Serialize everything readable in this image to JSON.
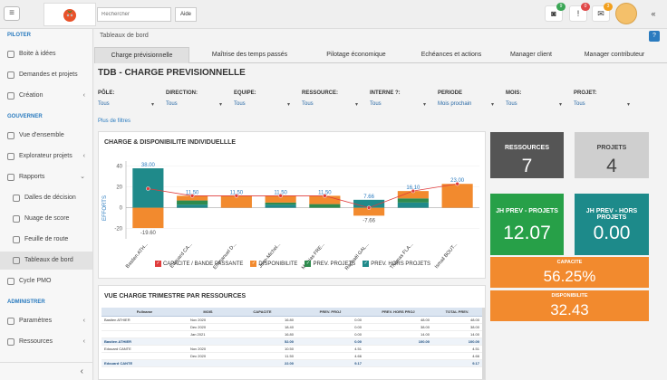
{
  "header": {
    "search_placeholder": "Rechercher",
    "aide_label": "Aide",
    "icons": [
      {
        "name": "camera-icon",
        "glyph": "◙",
        "badge": "9",
        "badge_color": "#3aa655"
      },
      {
        "name": "alert-icon",
        "glyph": "!",
        "badge": "0",
        "badge_color": "#e04848"
      },
      {
        "name": "mail-icon",
        "glyph": "✉",
        "badge": "3",
        "badge_color": "#f2a01e"
      }
    ],
    "collapse_glyph": "«"
  },
  "sidebar": {
    "sections": [
      {
        "title": "PILOTER",
        "items": [
          {
            "label": "Boite à idées",
            "sub": false,
            "active": false,
            "chevron": ""
          },
          {
            "label": "Demandes et projets",
            "sub": false,
            "active": false,
            "chevron": ""
          },
          {
            "label": "Création",
            "sub": false,
            "active": false,
            "chevron": "‹"
          }
        ]
      },
      {
        "title": "GOUVERNER",
        "items": [
          {
            "label": "Vue d'ensemble",
            "sub": false,
            "active": false,
            "chevron": ""
          },
          {
            "label": "Explorateur projets",
            "sub": false,
            "active": false,
            "chevron": "‹"
          },
          {
            "label": "Rapports",
            "sub": false,
            "active": false,
            "chevron": "⌄"
          },
          {
            "label": "Dalles de décision",
            "sub": true,
            "active": false,
            "chevron": ""
          },
          {
            "label": "Nuage de score",
            "sub": true,
            "active": false,
            "chevron": ""
          },
          {
            "label": "Feuille de route",
            "sub": true,
            "active": false,
            "chevron": ""
          },
          {
            "label": "Tableaux de bord",
            "sub": true,
            "active": true,
            "chevron": ""
          },
          {
            "label": "Cycle PMO",
            "sub": false,
            "active": false,
            "chevron": ""
          }
        ]
      },
      {
        "title": "ADMINISTRER",
        "items": [
          {
            "label": "Paramètres",
            "sub": false,
            "active": false,
            "chevron": "‹"
          },
          {
            "label": "Ressources",
            "sub": false,
            "active": false,
            "chevron": "‹"
          }
        ]
      }
    ],
    "footer_glyph": "‹"
  },
  "main": {
    "breadcrumb": "Tableaux de bord",
    "help_label": "?",
    "tabs": [
      {
        "label": "Charge prévisionnelle",
        "active": true
      },
      {
        "label": "Maîtrise des temps passés",
        "active": false
      },
      {
        "label": "Pilotage économique",
        "active": false
      },
      {
        "label": "Echéances et actions",
        "active": false
      },
      {
        "label": "Manager client",
        "active": false
      },
      {
        "label": "Manager contributeur",
        "active": false
      }
    ],
    "page_title": "TDB - CHARGE PREVISIONNELLE",
    "filters": [
      {
        "label": "PÔLE:",
        "value": "Tous"
      },
      {
        "label": "DIRECTION:",
        "value": "Tous"
      },
      {
        "label": "EQUIPE:",
        "value": "Tous"
      },
      {
        "label": "RESSOURCE:",
        "value": "Tous"
      },
      {
        "label": "INTERNE ?:",
        "value": "Tous"
      },
      {
        "label": "PERIODE",
        "value": "Mois prochain"
      },
      {
        "label": "MOIS:",
        "value": "Tous"
      },
      {
        "label": "PROJET:",
        "value": "Tous"
      }
    ],
    "more_filters": "Plus de filtres"
  },
  "chart_panel": {
    "title": "CHARGE & DISPONIBILITE INDIVIDUELLLE"
  },
  "chart_data": {
    "type": "bar",
    "ylabel": "EFFORTS",
    "ylim": [
      -30,
      45
    ],
    "yticks": [
      -20,
      0,
      20,
      40
    ],
    "categories": [
      "Bastien ATH...",
      "Edouard CA...",
      "Emmanuel D...",
      "Jean-Michel...",
      "Mathias FRE...",
      "Raphaël GAL...",
      "Thomas FLA...",
      "Ismail BOUT..."
    ],
    "series": [
      {
        "name": "PREV. HORS PROJETS",
        "color": "#1f8a8a",
        "values": [
          38.0,
          3.0,
          0,
          3.0,
          0,
          7.66,
          5.0,
          0
        ]
      },
      {
        "name": "PREV. PROJETS",
        "color": "#2e8b4e",
        "values": [
          0,
          4.0,
          0,
          2.0,
          3.5,
          0,
          4.0,
          0
        ]
      },
      {
        "name": "DISPONIBILITE",
        "color": "#f28a2e",
        "values": [
          -19.6,
          4.5,
          11.5,
          6.5,
          8.0,
          -7.66,
          7.1,
          23.0
        ]
      },
      {
        "name": "CAPACITE / BANDE PASSANTE",
        "color": "#e03c3c",
        "values": [
          18.4,
          11.5,
          11.5,
          11.5,
          11.5,
          0,
          16.1,
          23.0
        ]
      }
    ],
    "data_labels": [
      "38.00",
      "11.50",
      "11.50",
      "11.50",
      "11.50",
      "7.66",
      "16.10",
      "23.00"
    ],
    "bottom_labels": [
      "-19.60",
      "",
      "",
      "",
      "",
      "-7.66",
      "",
      ""
    ],
    "legend": [
      {
        "label": "CAPACITE / BANDE PASSANTE",
        "color": "#e03c3c",
        "mark": "✓"
      },
      {
        "label": "DISPONIBILITE",
        "color": "#f28a2e",
        "mark": "✓"
      },
      {
        "label": "PREV. PROJETS",
        "color": "#2e8b4e",
        "mark": "✓"
      },
      {
        "label": "PREV. HORS PROJETS",
        "color": "#1f8a8a",
        "mark": "✓"
      }
    ]
  },
  "table_panel": {
    "title": "VUE CHARGE TRIMESTRE PAR RESSOURCES",
    "headers": [
      "Fullname",
      "MOIS",
      "CAPACITE",
      "PREV. PROJ",
      "PREV. HORS PROJ",
      "TOTAL PREV."
    ],
    "rows": [
      {
        "cells": [
          "Bastien ATHIER",
          "Nov 2020",
          "16.80",
          "0.00",
          "48.00",
          "48.00"
        ],
        "total": false
      },
      {
        "cells": [
          "",
          "Dec 2020",
          "18.40",
          "0.00",
          "38.00",
          "38.00"
        ],
        "total": false
      },
      {
        "cells": [
          "",
          "Jan 2021",
          "16.80",
          "0.00",
          "14.00",
          "14.00"
        ],
        "total": false
      },
      {
        "cells": [
          "Bastien ATHIER",
          "",
          "52.00",
          "0.00",
          "100.00",
          "100.00"
        ],
        "total": true
      },
      {
        "cells": [
          "Edouard CANTE",
          "Nov 2020",
          "10.50",
          "4.51",
          "",
          "4.51"
        ],
        "total": false
      },
      {
        "cells": [
          "",
          "Dec 2020",
          "11.50",
          "4.66",
          "",
          "4.66"
        ],
        "total": false
      },
      {
        "cells": [
          "Edouard CANTE",
          "",
          "22.00",
          "9.17",
          "",
          "9.17"
        ],
        "total": true
      }
    ]
  },
  "kpis": [
    {
      "name": "kpi-ressources",
      "label": "RESSOURCES",
      "value": "7",
      "color": "#555555",
      "text_color": "#ffffff"
    },
    {
      "name": "kpi-projets",
      "label": "PROJETS",
      "value": "4",
      "color": "#cfcfcf",
      "text_color": "#444444"
    },
    {
      "name": "kpi-jh-prev-projets",
      "label": "JH PREV - PROJETS",
      "value": "12.07",
      "color": "#27a048",
      "text_color": "#ffffff"
    },
    {
      "name": "kpi-jh-prev-hors-projets",
      "label": "JH PREV - HORS PROJETS",
      "value": "0.00",
      "color": "#1d8a8a",
      "text_color": "#ffffff"
    },
    {
      "name": "kpi-capacite",
      "label": "CAPACITE",
      "value": "56.25%",
      "color": "#f28a2e",
      "text_color": "#ffffff"
    },
    {
      "name": "kpi-disponibilite",
      "label": "DISPONIBILITE",
      "value": "32.43",
      "color": "#f28a2e",
      "text_color": "#ffffff"
    }
  ]
}
